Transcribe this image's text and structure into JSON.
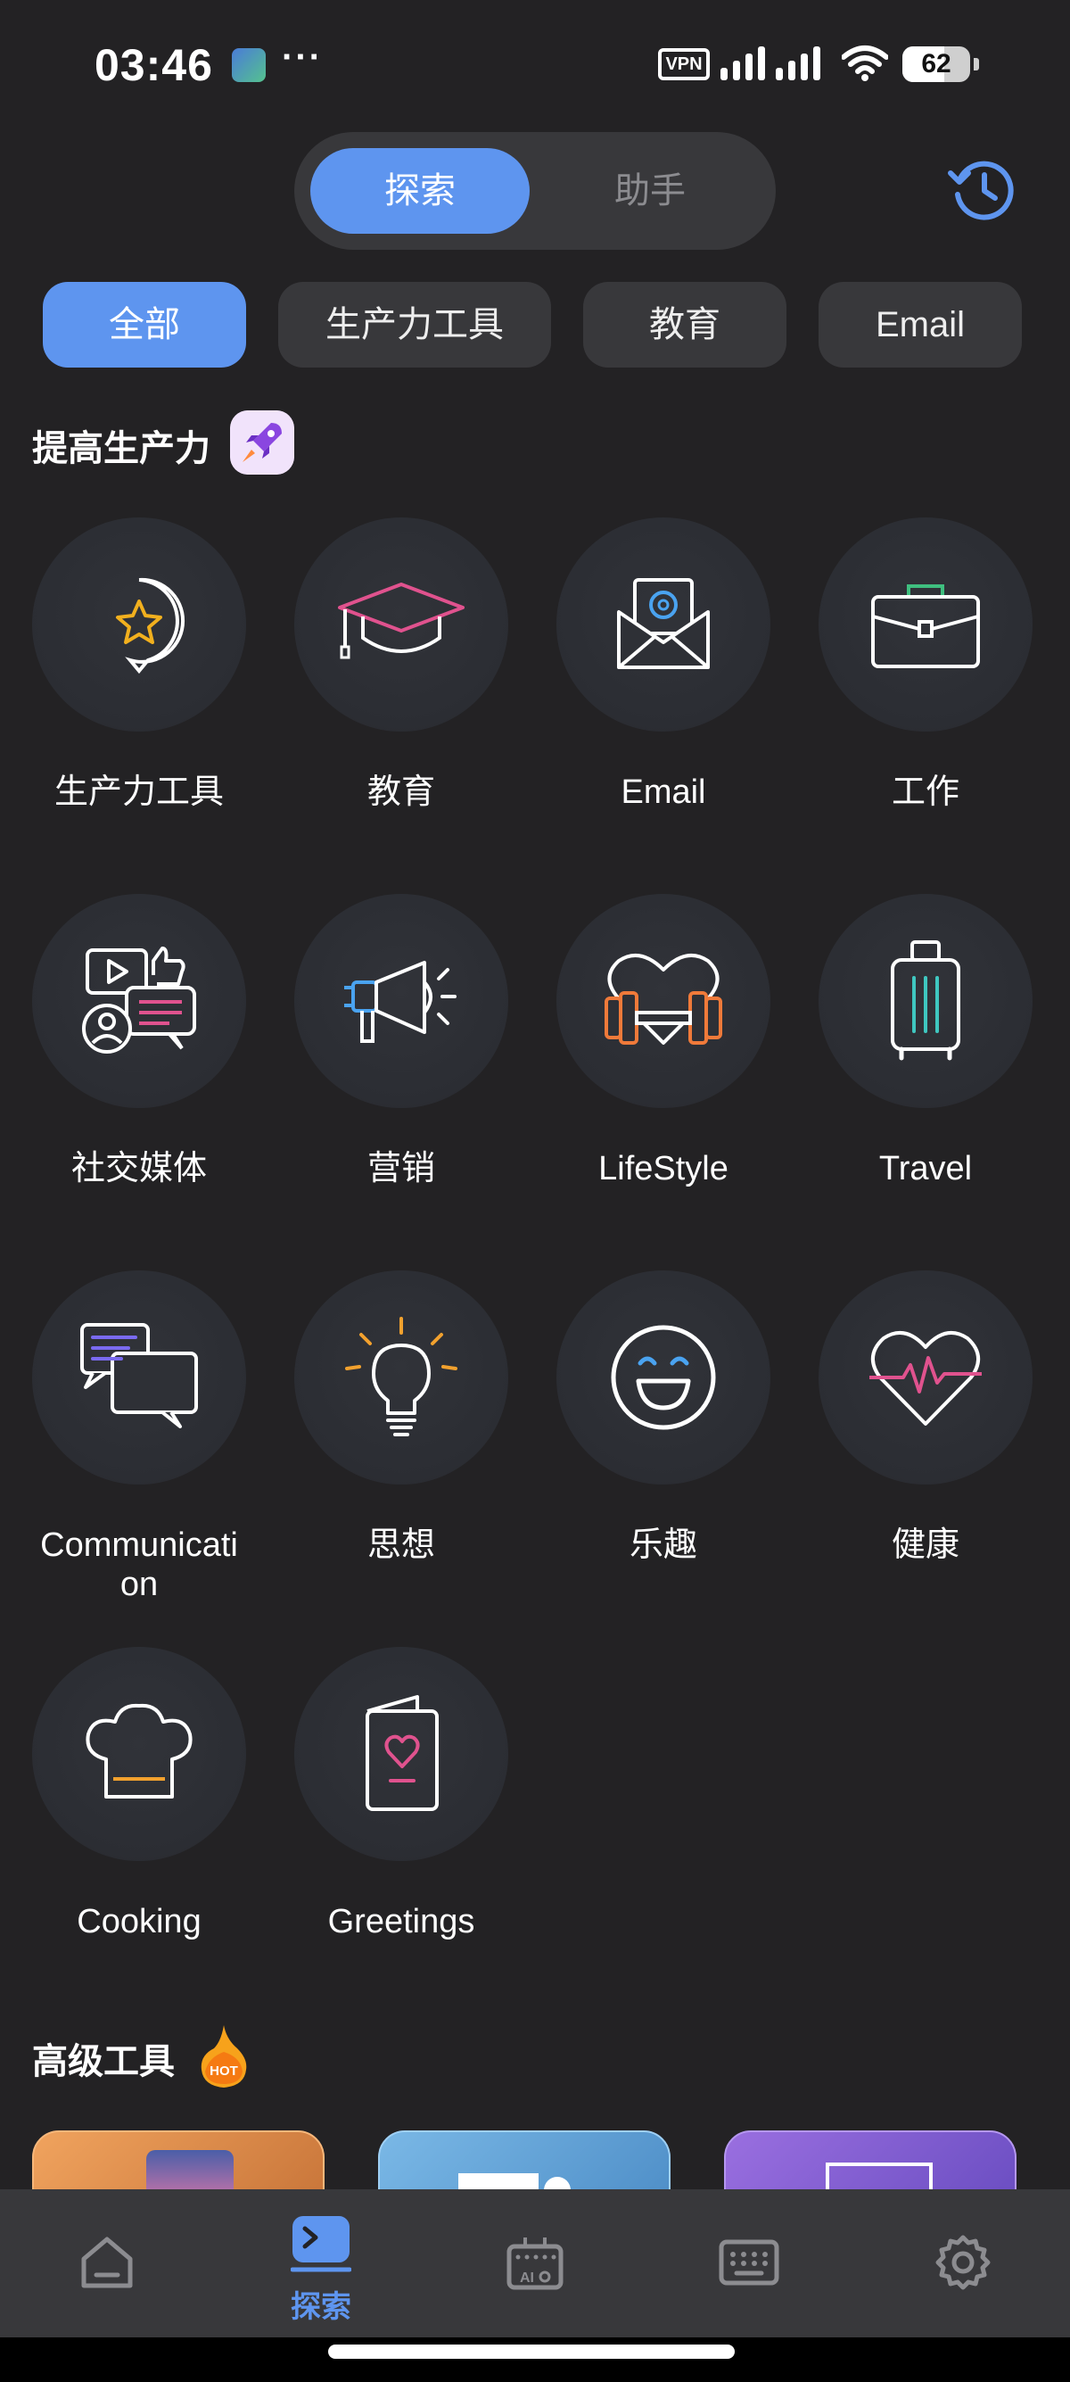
{
  "status_bar": {
    "time": "03:46",
    "more": "···",
    "vpn": "VPN",
    "battery_level": "62",
    "battery_fraction": 0.62
  },
  "top_tabs": [
    {
      "label": "探索",
      "active": true
    },
    {
      "label": "助手",
      "active": false
    }
  ],
  "history_icon": "history-clock-icon",
  "filters": [
    {
      "label": "全部",
      "active": true
    },
    {
      "label": "生产力工具",
      "active": false
    },
    {
      "label": "教育",
      "active": false
    },
    {
      "label": "Email",
      "active": false
    }
  ],
  "section_productivity": {
    "title": "提高生产力",
    "icon": "rocket-icon"
  },
  "categories": [
    {
      "label": "生产力工具",
      "icon": "star-bubble-icon"
    },
    {
      "label": "教育",
      "icon": "graduation-cap-icon"
    },
    {
      "label": "Email",
      "icon": "email-envelope-icon"
    },
    {
      "label": "工作",
      "icon": "briefcase-icon"
    },
    {
      "label": "社交媒体",
      "icon": "social-media-icon"
    },
    {
      "label": "营销",
      "icon": "megaphone-icon"
    },
    {
      "label": "LifeStyle",
      "icon": "heart-dumbbell-icon"
    },
    {
      "label": "Travel",
      "icon": "suitcase-icon"
    },
    {
      "label": "Communication",
      "icon": "chat-bubbles-icon"
    },
    {
      "label": "思想",
      "icon": "lightbulb-icon"
    },
    {
      "label": "乐趣",
      "icon": "smiley-icon"
    },
    {
      "label": "健康",
      "icon": "heart-pulse-icon"
    },
    {
      "label": "Cooking",
      "icon": "chef-hat-icon"
    },
    {
      "label": "Greetings",
      "icon": "greeting-card-icon"
    }
  ],
  "section_premium": {
    "title": "高级工具",
    "icon": "hot-flame-icon",
    "badge": "HOT"
  },
  "bottom_nav": [
    {
      "icon": "home-icon",
      "label": ""
    },
    {
      "icon": "explore-terminal-icon",
      "label": "探索",
      "active": true
    },
    {
      "icon": "ai-keyboard-icon",
      "label": ""
    },
    {
      "icon": "keyboard-icon",
      "label": ""
    },
    {
      "icon": "settings-gear-icon",
      "label": ""
    }
  ],
  "colors": {
    "accent": "#5e95ef",
    "background": "#232224",
    "chip": "#38383b"
  }
}
